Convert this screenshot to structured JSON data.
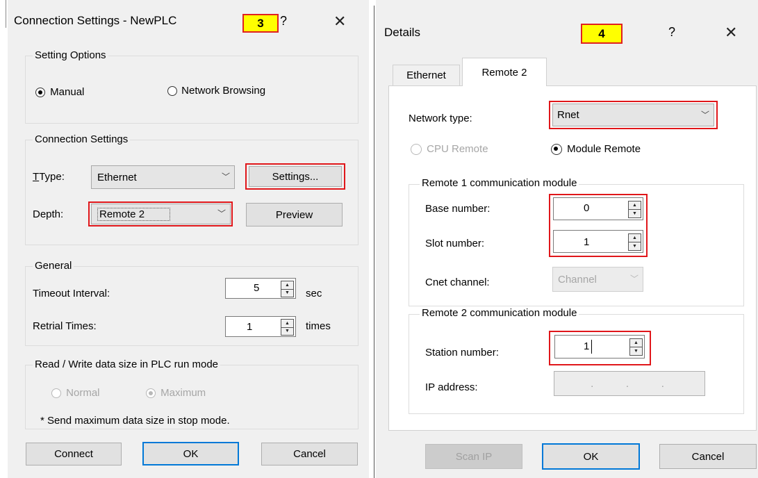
{
  "left_dialog": {
    "title": "Connection Settings - NewPLC",
    "badge": "3",
    "help_glyph": "?",
    "close_glyph": "✕",
    "setting_options": {
      "legend": "Setting Options",
      "manual_label": "Manual",
      "network_browsing_label": "Network Browsing",
      "selected": "Manual"
    },
    "connection_settings": {
      "legend": "Connection Settings",
      "type_label": "Type:",
      "type_value": "Ethernet",
      "settings_button": "Settings...",
      "depth_label": "Depth:",
      "depth_value": "Remote 2",
      "preview_button": "Preview"
    },
    "general": {
      "legend": "General",
      "timeout_label": "Timeout Interval:",
      "timeout_value": "5",
      "timeout_unit": "sec",
      "retrial_label": "Retrial Times:",
      "retrial_value": "1",
      "retrial_unit": "times"
    },
    "read_write": {
      "legend": "Read / Write data size in PLC run mode",
      "normal_label": "Normal",
      "maximum_label": "Maximum",
      "note": "* Send maximum data size in stop mode."
    },
    "buttons": {
      "connect": "Connect",
      "ok": "OK",
      "cancel": "Cancel"
    }
  },
  "right_dialog": {
    "title": "Details",
    "badge": "4",
    "help_glyph": "?",
    "close_glyph": "✕",
    "tabs": [
      "Ethernet",
      "Remote 2"
    ],
    "active_tab": "Remote 2",
    "network_type_label": "Network type:",
    "network_type_value": "Rnet",
    "cpu_remote_label": "CPU Remote",
    "module_remote_label": "Module Remote",
    "remote1": {
      "legend": "Remote 1 communication module",
      "base_label": "Base number:",
      "base_value": "0",
      "slot_label": "Slot number:",
      "slot_value": "1",
      "cnet_label": "Cnet channel:",
      "cnet_value": "Channel"
    },
    "remote2": {
      "legend": "Remote 2 communication module",
      "station_label": "Station number:",
      "station_value": "1",
      "ip_label": "IP address:",
      "ip_value": ".    .    ."
    },
    "buttons": {
      "scan_ip": "Scan IP",
      "ok": "OK",
      "cancel": "Cancel"
    }
  },
  "colors": {
    "highlight_red": "#e0161a",
    "badge_yellow": "#ffff00",
    "default_blue": "#0078d7",
    "dialog_bg": "#f0f0f0"
  }
}
